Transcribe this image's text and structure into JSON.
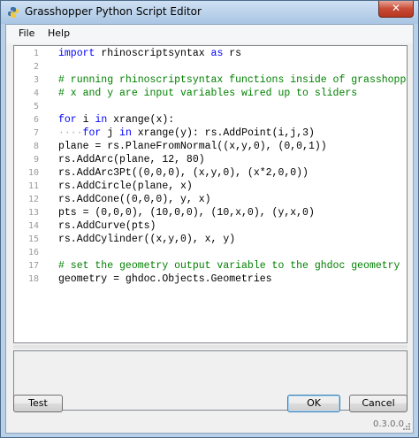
{
  "window": {
    "title": "Grasshopper Python Script Editor"
  },
  "menu": {
    "file": "File",
    "help": "Help"
  },
  "editor": {
    "line_numbers": [
      "1",
      "2",
      "3",
      "4",
      "5",
      "6",
      "7",
      "8",
      "9",
      "10",
      "11",
      "12",
      "13",
      "14",
      "15",
      "16",
      "17",
      "18"
    ],
    "lines": [
      {
        "parts": [
          {
            "t": "import",
            "c": "kw"
          },
          {
            "t": " rhinoscriptsyntax ",
            "c": ""
          },
          {
            "t": "as",
            "c": "kw"
          },
          {
            "t": " rs",
            "c": ""
          }
        ]
      },
      {
        "parts": []
      },
      {
        "parts": [
          {
            "t": "# running rhinoscriptsyntax functions inside of grasshoppe",
            "c": "cm"
          }
        ]
      },
      {
        "parts": [
          {
            "t": "# x and y are input variables wired up to sliders",
            "c": "cm"
          }
        ]
      },
      {
        "parts": []
      },
      {
        "parts": [
          {
            "t": "for",
            "c": "kw"
          },
          {
            "t": " i ",
            "c": ""
          },
          {
            "t": "in",
            "c": "kw"
          },
          {
            "t": " xrange(x):",
            "c": ""
          }
        ]
      },
      {
        "parts": [
          {
            "t": "····",
            "c": "dots"
          },
          {
            "t": "for",
            "c": "kw"
          },
          {
            "t": " j ",
            "c": ""
          },
          {
            "t": "in",
            "c": "kw"
          },
          {
            "t": " xrange(y): rs.AddPoint(i,j,3)",
            "c": ""
          }
        ]
      },
      {
        "parts": [
          {
            "t": "plane = rs.PlaneFromNormal((x,y,0), (0,0,1))",
            "c": ""
          }
        ]
      },
      {
        "parts": [
          {
            "t": "rs.AddArc(plane, 12, 80)",
            "c": ""
          }
        ]
      },
      {
        "parts": [
          {
            "t": "rs.AddArc3Pt((0,0,0), (x,y,0), (x*2,0,0))",
            "c": ""
          }
        ]
      },
      {
        "parts": [
          {
            "t": "rs.AddCircle(plane, x)",
            "c": ""
          }
        ]
      },
      {
        "parts": [
          {
            "t": "rs.AddCone((0,0,0), y, x)",
            "c": ""
          }
        ]
      },
      {
        "parts": [
          {
            "t": "pts = (0,0,0), (10,0,0), (10,x,0), (y,x,0)",
            "c": ""
          }
        ]
      },
      {
        "parts": [
          {
            "t": "rs.AddCurve(pts)",
            "c": ""
          }
        ]
      },
      {
        "parts": [
          {
            "t": "rs.AddCylinder((x,y,0), x, y)",
            "c": ""
          }
        ]
      },
      {
        "parts": []
      },
      {
        "parts": [
          {
            "t": "# set the geometry output variable to the ghdoc geometry",
            "c": "cm"
          }
        ]
      },
      {
        "parts": [
          {
            "t": "geometry = ghdoc.Objects.Geometries",
            "c": ""
          }
        ]
      }
    ]
  },
  "buttons": {
    "test": "Test",
    "ok": "OK",
    "cancel": "Cancel"
  },
  "status": {
    "version": "0.3.0.0"
  },
  "colors": {
    "keyword": "#0000ff",
    "comment": "#008000",
    "line_number": "#9a9a9a"
  },
  "icons": {
    "app": "python-logo-icon",
    "close": "close-icon",
    "grip": "resize-grip-icon"
  }
}
